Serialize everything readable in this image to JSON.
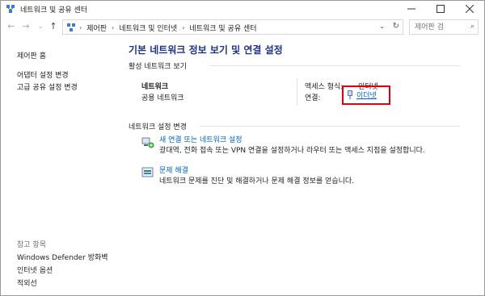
{
  "window": {
    "title": "네트워크 및 공유 센터"
  },
  "address": {
    "breadcrumbs": [
      "제어판",
      "네트워크 및 인터넷",
      "네트워크 및 공유 센터"
    ],
    "search_placeholder": "제어판 검"
  },
  "sidebar": {
    "links": [
      "제어판 홈",
      "어댑터 설정 변경",
      "고급 공유 설정 변경"
    ],
    "see_also_heading": "참고 항목",
    "see_also": [
      "Windows Defender 방화벽",
      "인터넷 옵션",
      "적외선"
    ]
  },
  "main": {
    "title": "기본 네트워크 정보 보기 및 연결 설정",
    "active_networks_heading": "활성 네트워크 보기",
    "network": {
      "name": "네트워크",
      "type": "공용 네트워크",
      "access_type_label": "액세스 형식:",
      "access_type_value": "인터넷",
      "connections_label": "연결:",
      "connection_value": "이더넷"
    },
    "change_settings_heading": "네트워크 설정 변경",
    "tasks": [
      {
        "link": "새 연결 또는 네트워크 설정",
        "desc": "광대역, 전화 접속 또는 VPN 연결을 설정하거나 라우터 또는 액세스 지점을 설정합니다."
      },
      {
        "link": "문제 해결",
        "desc": "네트워크 문제를 진단 및 해결하거나 문제 해결 정보를 얻습니다."
      }
    ]
  },
  "colors": {
    "link": "#0066cc",
    "title": "#1e3287",
    "highlight": "#e2000f"
  }
}
